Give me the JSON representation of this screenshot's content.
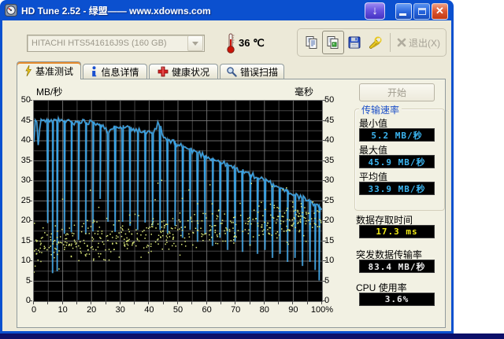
{
  "window": {
    "title": "HD Tune 2.52 - 绿盟—— www.xdowns.com",
    "download_glyph": "↓",
    "close_glyph": "✕"
  },
  "toolbar": {
    "drive_selector": {
      "value": "HITACHI HTS541616J9S (160 GB)"
    },
    "temperature": "36 ℃",
    "exit_label": "退出(X)"
  },
  "tabs": [
    {
      "label": "基准测试",
      "selected": true
    },
    {
      "label": "信息详情",
      "selected": false
    },
    {
      "label": "健康状况",
      "selected": false
    },
    {
      "label": "错误扫描",
      "selected": false
    }
  ],
  "benchmark": {
    "start_button": "开始",
    "transfer_rate_group": {
      "title": "传输速率",
      "min_label": "最小值",
      "min_value": "5.2 MB/秒",
      "max_label": "最大值",
      "max_value": "45.9 MB/秒",
      "avg_label": "平均值",
      "avg_value": "33.9 MB/秒"
    },
    "access_time_label": "数据存取时间",
    "access_time_value": "17.3 ms",
    "burst_rate_label": "突发数据传输率",
    "burst_rate_value": "83.4 MB/秒",
    "cpu_usage_label": "CPU 使用率",
    "cpu_usage_value": "3.6%"
  },
  "colors": {
    "lcd_cyan": "#3cb6f2",
    "lcd_yellow": "#f2ec16",
    "lcd_white": "#ededed",
    "accent_orange_tab": "#e68b2c",
    "titlebar_blue": "#1258e0"
  },
  "chart_data": {
    "type": "line",
    "title": "",
    "left_axis": {
      "label": "MB/秒",
      "min": 0,
      "max": 50,
      "tick_step": 5,
      "tick_labels": [
        "50",
        "45",
        "40",
        "35",
        "30",
        "25",
        "20",
        "15",
        "10",
        "5",
        "0"
      ]
    },
    "right_axis": {
      "label": "毫秒",
      "min": 0,
      "max": 50,
      "tick_step": 5,
      "tick_labels": [
        "50",
        "45",
        "40",
        "35",
        "30",
        "25",
        "20",
        "15",
        "10",
        "5",
        "0"
      ]
    },
    "x_axis": {
      "min": 0,
      "max": 100,
      "unit": "%",
      "tick_labels": [
        "0",
        "10",
        "20",
        "30",
        "40",
        "50",
        "60",
        "70",
        "80",
        "90",
        "100%"
      ]
    },
    "plot_bg": "#000000",
    "grid_color": "#7d7d7d",
    "grid_minor_step_y": 2.5,
    "grid_minor_step_x": 5,
    "series": [
      {
        "name": "transfer_rate",
        "type": "line",
        "color": "#38a3e6",
        "axis": "left",
        "keypoints": [
          [
            0,
            39.5
          ],
          [
            0.3,
            45.8
          ],
          [
            1,
            44.2
          ],
          [
            1.6,
            38.2
          ],
          [
            2.2,
            45.4
          ],
          [
            3,
            44.6
          ],
          [
            4,
            45.3
          ],
          [
            6,
            44.8
          ],
          [
            8,
            45.2
          ],
          [
            10,
            44.6
          ],
          [
            12,
            45.1
          ],
          [
            14,
            44.4
          ],
          [
            16,
            45.0
          ],
          [
            18,
            44.6
          ],
          [
            20,
            44.9
          ],
          [
            22,
            44.4
          ],
          [
            24,
            43.8
          ],
          [
            26,
            41.5
          ],
          [
            27.5,
            43.6
          ],
          [
            29,
            43.9
          ],
          [
            31,
            43.3
          ],
          [
            33,
            43.6
          ],
          [
            35,
            42.8
          ],
          [
            37,
            42.4
          ],
          [
            39,
            42.0
          ],
          [
            41,
            41.6
          ],
          [
            43,
            44.0
          ],
          [
            44,
            43.4
          ],
          [
            45,
            40.6
          ],
          [
            47,
            40.0
          ],
          [
            49,
            39.4
          ],
          [
            51,
            38.8
          ],
          [
            53,
            38.2
          ],
          [
            55,
            37.6
          ],
          [
            57,
            37.0
          ],
          [
            59,
            36.4
          ],
          [
            61,
            35.8
          ],
          [
            63,
            35.2
          ],
          [
            65,
            34.6
          ],
          [
            67,
            34.0
          ],
          [
            69,
            33.4
          ],
          [
            71,
            32.8
          ],
          [
            73,
            32.2
          ],
          [
            75,
            31.6
          ],
          [
            77,
            31.0
          ],
          [
            79,
            30.4
          ],
          [
            81,
            29.8
          ],
          [
            83,
            29.2
          ],
          [
            85,
            28.4
          ],
          [
            87,
            27.8
          ],
          [
            89,
            27.2
          ],
          [
            91,
            26.4
          ],
          [
            93,
            25.8
          ],
          [
            95,
            25.0
          ],
          [
            97,
            24.4
          ],
          [
            99,
            23.6
          ],
          [
            100,
            23.2
          ]
        ],
        "spikes": [
          [
            4.8,
            19.5
          ],
          [
            6.5,
            7.0
          ],
          [
            8.1,
            7.5
          ],
          [
            10.6,
            16.8
          ],
          [
            13,
            17.2
          ],
          [
            15.5,
            15.3
          ],
          [
            18,
            16.8
          ],
          [
            20.5,
            17.4
          ],
          [
            23,
            25.5
          ],
          [
            25.7,
            19.8
          ],
          [
            28.2,
            17.3
          ],
          [
            30.8,
            19.8
          ],
          [
            33.4,
            18.8
          ],
          [
            36,
            17.8
          ],
          [
            38.6,
            19.6
          ],
          [
            41.2,
            18.9
          ],
          [
            43.8,
            17.8
          ],
          [
            46.4,
            16.9
          ],
          [
            49,
            18.8
          ],
          [
            51.6,
            15.8
          ],
          [
            54.2,
            17.8
          ],
          [
            56.8,
            14.8
          ],
          [
            59.4,
            16.8
          ],
          [
            62,
            13.8
          ],
          [
            64.6,
            15.8
          ],
          [
            67.2,
            12.8
          ],
          [
            69.8,
            14.8
          ],
          [
            72.4,
            12.3
          ],
          [
            75,
            13.8
          ],
          [
            77.6,
            11.8
          ],
          [
            80.2,
            12.8
          ],
          [
            82.8,
            10.8
          ],
          [
            85.4,
            11.8
          ],
          [
            88,
            9.8
          ],
          [
            90.6,
            10.8
          ],
          [
            93.2,
            8.8
          ],
          [
            95.8,
            9.8
          ],
          [
            97.6,
            7.8
          ],
          [
            99,
            5.2
          ]
        ],
        "noise_amp": 1.4,
        "noise_seed": 11
      },
      {
        "name": "access_time_dots",
        "type": "scatter",
        "color": "#dce87a",
        "axis": "right",
        "count": 520,
        "seed": 29,
        "y_base": 13.5,
        "y_slope_per_pct": 0.07,
        "y_spread": 7,
        "y_min": 2.5,
        "y_max": 31,
        "outlier_chance": 0.04,
        "outlier_extra": 14
      }
    ]
  }
}
